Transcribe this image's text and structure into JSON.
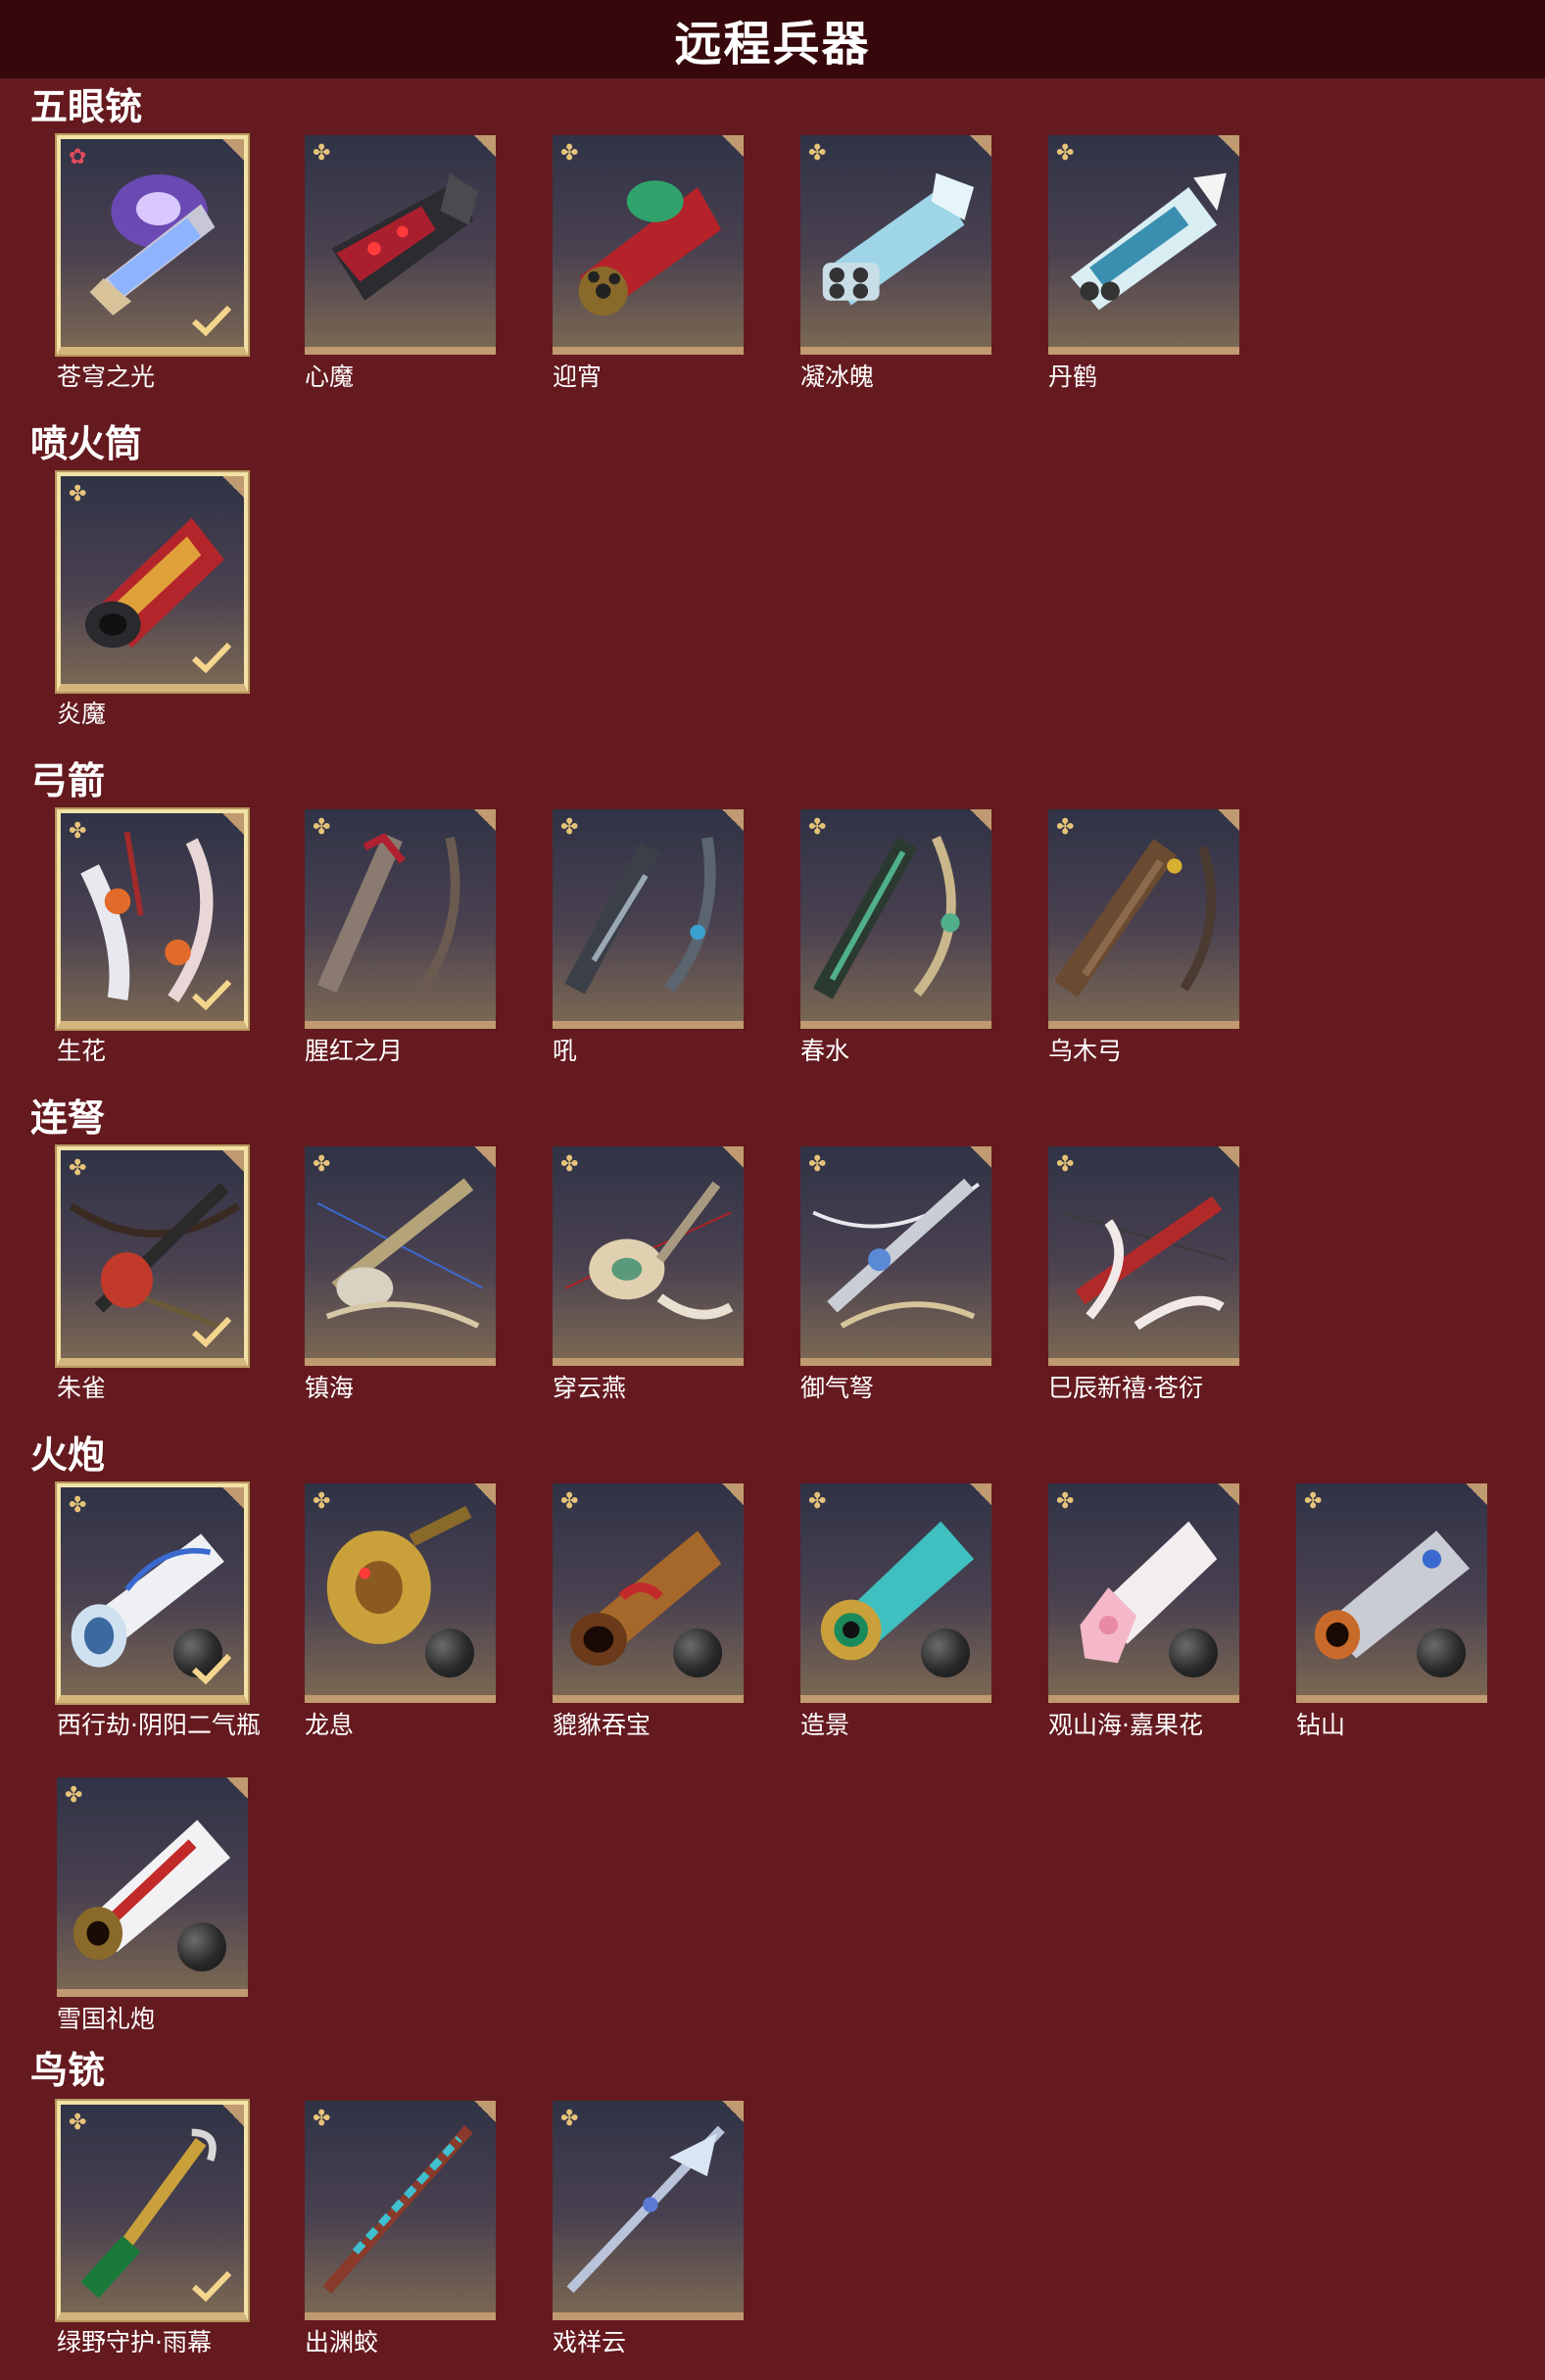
{
  "header": {
    "title": "远程兵器"
  },
  "sections": [
    {
      "title": "五眼铳",
      "items": [
        {
          "name": "苍穹之光",
          "rarity_icon": "star-icon",
          "selected": true
        },
        {
          "name": "心魔",
          "rarity_icon": "sparkle-icon",
          "selected": false
        },
        {
          "name": "迎宵",
          "rarity_icon": "sparkle-icon",
          "selected": false
        },
        {
          "name": "凝冰魄",
          "rarity_icon": "sparkle-icon",
          "selected": false
        },
        {
          "name": "丹鹤",
          "rarity_icon": "sparkle-icon",
          "selected": false
        }
      ]
    },
    {
      "title": "喷火筒",
      "items": [
        {
          "name": "炎魔",
          "rarity_icon": "sparkle-icon",
          "selected": true
        }
      ]
    },
    {
      "title": "弓箭",
      "items": [
        {
          "name": "生花",
          "rarity_icon": "sparkle-icon",
          "selected": true
        },
        {
          "name": "腥红之月",
          "rarity_icon": "sparkle-icon",
          "selected": false
        },
        {
          "name": "吼",
          "rarity_icon": "sparkle-icon",
          "selected": false
        },
        {
          "name": "春水",
          "rarity_icon": "sparkle-icon",
          "selected": false
        },
        {
          "name": "乌木弓",
          "rarity_icon": "sparkle-icon",
          "selected": false
        }
      ]
    },
    {
      "title": "连弩",
      "items": [
        {
          "name": "朱雀",
          "rarity_icon": "sparkle-icon",
          "selected": true
        },
        {
          "name": "镇海",
          "rarity_icon": "sparkle-icon",
          "selected": false
        },
        {
          "name": "穿云燕",
          "rarity_icon": "sparkle-icon",
          "selected": false
        },
        {
          "name": "御气弩",
          "rarity_icon": "sparkle-icon",
          "selected": false
        },
        {
          "name": "巳辰新禧·苍衍",
          "rarity_icon": "sparkle-icon",
          "selected": false
        }
      ]
    },
    {
      "title": "火炮",
      "items": [
        {
          "name": "西行劫·阴阳二气瓶",
          "rarity_icon": "sparkle-icon",
          "selected": true
        },
        {
          "name": "龙息",
          "rarity_icon": "sparkle-icon",
          "selected": false
        },
        {
          "name": "貔貅吞宝",
          "rarity_icon": "sparkle-icon",
          "selected": false
        },
        {
          "name": "造景",
          "rarity_icon": "sparkle-icon",
          "selected": false
        },
        {
          "name": "观山海·嘉果花",
          "rarity_icon": "sparkle-icon",
          "selected": false
        },
        {
          "name": "钻山",
          "rarity_icon": "sparkle-icon",
          "selected": false
        },
        {
          "name": "雪国礼炮",
          "rarity_icon": "sparkle-icon",
          "selected": false
        }
      ]
    },
    {
      "title": "鸟铳",
      "items": [
        {
          "name": "绿野守护·雨幕",
          "rarity_icon": "sparkle-icon",
          "selected": true
        },
        {
          "name": "出渊蛟",
          "rarity_icon": "sparkle-icon",
          "selected": false
        },
        {
          "name": "戏祥云",
          "rarity_icon": "sparkle-icon",
          "selected": false
        }
      ]
    }
  ],
  "colors": {
    "background": "#651a1f",
    "header_bg": "#36070b",
    "card_border": "#c09a70",
    "selected_border": "#f3e2a5",
    "check": "#f4d58d"
  }
}
